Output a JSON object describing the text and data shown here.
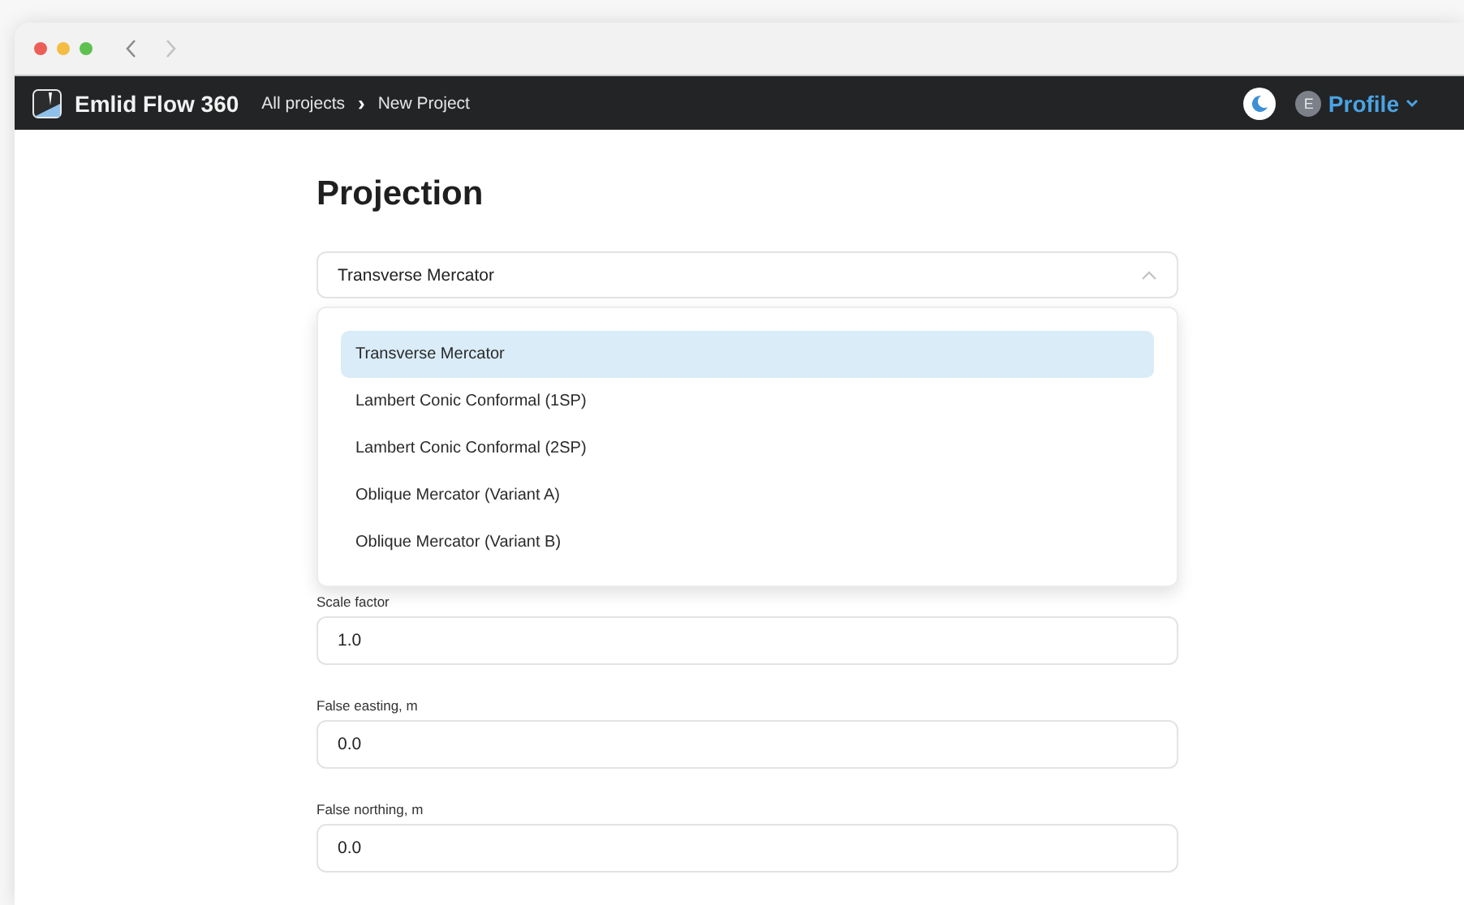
{
  "navbar": {
    "app_name": "Emlid Flow 360",
    "breadcrumb": [
      "All projects",
      "New Project"
    ],
    "breadcrumb_separator": "›",
    "avatar_letter": "E",
    "profile_label": "Profile"
  },
  "heading": "Projection",
  "projection_select": {
    "value": "Transverse Mercator",
    "expanded": true,
    "options": [
      {
        "label": "Transverse Mercator",
        "selected": true
      },
      {
        "label": "Lambert Conic Conformal (1SP)",
        "selected": false
      },
      {
        "label": "Lambert Conic Conformal (2SP)",
        "selected": false
      },
      {
        "label": "Oblique Mercator (Variant A)",
        "selected": false
      },
      {
        "label": "Oblique Mercator (Variant B)",
        "selected": false
      }
    ]
  },
  "fields": [
    {
      "label": "Scale factor",
      "value": "1.0"
    },
    {
      "label": "False easting, m",
      "value": "0.0"
    },
    {
      "label": "False northing, m",
      "value": "0.0"
    }
  ]
}
